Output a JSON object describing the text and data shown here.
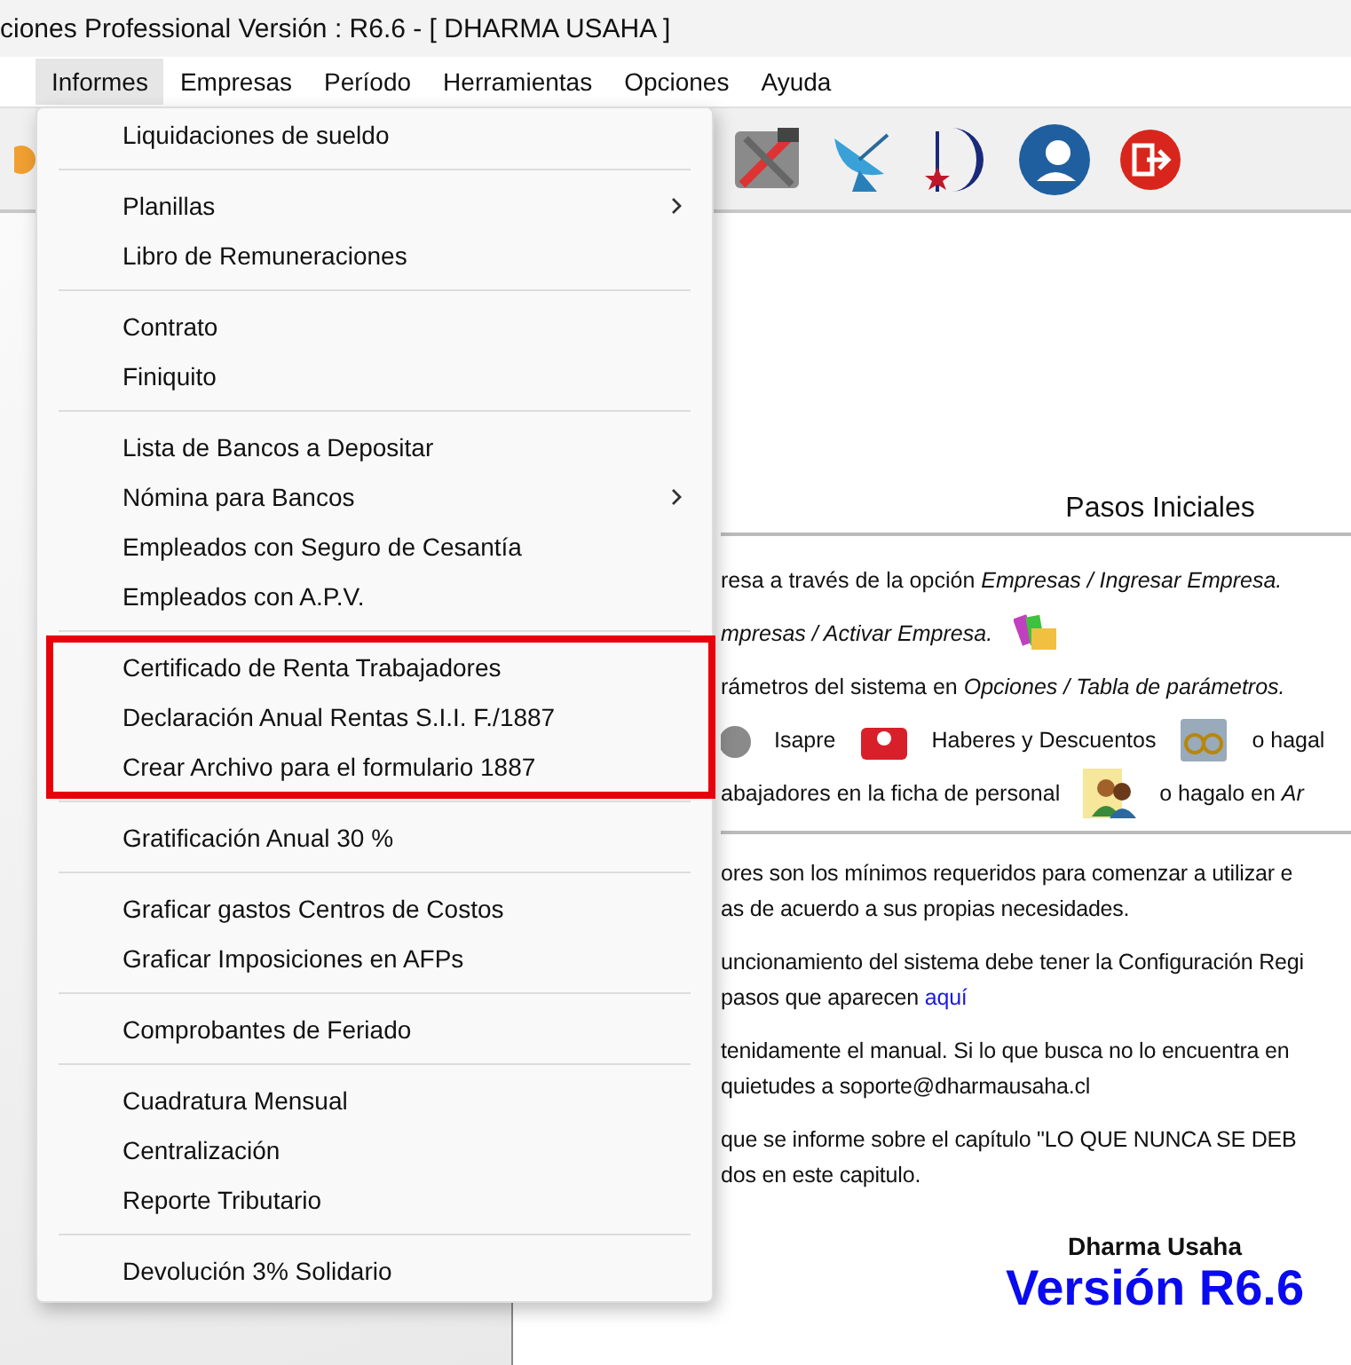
{
  "window": {
    "title": "ciones Professional Versión : R6.6  - [ DHARMA USAHA ]"
  },
  "menu_bar": [
    {
      "label": "Informes",
      "selected": true
    },
    {
      "label": "Empresas",
      "selected": false
    },
    {
      "label": "Período",
      "selected": false
    },
    {
      "label": "Herramientas",
      "selected": false
    },
    {
      "label": "Opciones",
      "selected": false
    },
    {
      "label": "Ayuda",
      "selected": false
    }
  ],
  "toolbar_icons": [
    {
      "kind": "tools"
    },
    {
      "kind": "dish"
    },
    {
      "kind": "logo"
    },
    {
      "kind": "support"
    },
    {
      "kind": "exit"
    }
  ],
  "dropdown": {
    "groups": [
      {
        "highlighted": false,
        "items": [
          {
            "label": "Liquidaciones de sueldo",
            "submenu": false
          }
        ]
      },
      {
        "highlighted": false,
        "items": [
          {
            "label": "Planillas",
            "submenu": true
          },
          {
            "label": "Libro de Remuneraciones",
            "submenu": false
          }
        ]
      },
      {
        "highlighted": false,
        "items": [
          {
            "label": "Contrato",
            "submenu": false
          },
          {
            "label": "Finiquito",
            "submenu": false
          }
        ]
      },
      {
        "highlighted": false,
        "items": [
          {
            "label": "Lista de Bancos a Depositar",
            "submenu": false
          },
          {
            "label": "Nómina para Bancos",
            "submenu": true
          },
          {
            "label": "Empleados con Seguro de Cesantía",
            "submenu": false
          },
          {
            "label": "Empleados con A.P.V.",
            "submenu": false
          }
        ]
      },
      {
        "highlighted": true,
        "items": [
          {
            "label": "Certificado de Renta Trabajadores",
            "submenu": false
          },
          {
            "label": "Declaración Anual Rentas S.I.I. F./1887",
            "submenu": false
          },
          {
            "label": "Crear Archivo para el formulario 1887",
            "submenu": false
          }
        ]
      },
      {
        "highlighted": false,
        "items": [
          {
            "label": "Gratificación Anual 30 %",
            "submenu": false
          }
        ]
      },
      {
        "highlighted": false,
        "items": [
          {
            "label": "Graficar gastos Centros de Costos",
            "submenu": false
          },
          {
            "label": "Graficar Imposiciones en AFPs",
            "submenu": false
          }
        ]
      },
      {
        "highlighted": false,
        "items": [
          {
            "label": "Comprobantes de Feriado",
            "submenu": false
          }
        ]
      },
      {
        "highlighted": false,
        "items": [
          {
            "label": "Cuadratura Mensual",
            "submenu": false
          },
          {
            "label": "Centralización",
            "submenu": false
          },
          {
            "label": "Reporte Tributario",
            "submenu": false
          }
        ]
      },
      {
        "highlighted": false,
        "items": [
          {
            "label": "Devolución 3% Solidario",
            "submenu": false
          }
        ]
      }
    ]
  },
  "panel": {
    "heading": "Pasos Iniciales",
    "steps": [
      [
        {
          "kind": "text",
          "text": "resa a través de la opción *Empresas / Ingresar Empresa.*"
        }
      ],
      [
        {
          "kind": "text",
          "text": "*mpresas / Activar Empresa.*"
        },
        {
          "kind": "folders"
        }
      ],
      [
        {
          "kind": "text",
          "text": "rámetros del sistema en *Opciones / Tabla de parámetros.*"
        }
      ],
      [
        {
          "kind": "piggy"
        },
        {
          "kind": "text",
          "text": "Isapre"
        },
        {
          "kind": "firstaid"
        },
        {
          "kind": "text",
          "text": "Haberes y Descuentos"
        },
        {
          "kind": "calculator"
        },
        {
          "kind": "text",
          "text": "o hagal"
        }
      ],
      [
        {
          "kind": "text",
          "text": "abajadores en la ficha de personal"
        },
        {
          "kind": "people"
        },
        {
          "kind": "text",
          "text": "o hagalo en  *Ar*"
        }
      ]
    ],
    "notes": [
      {
        "lines": [
          {
            "text": "ores son los mínimos requeridos para comenzar a utilizar e"
          },
          {
            "text": "as de acuerdo a sus propias necesidades."
          }
        ]
      },
      {
        "lines": [
          {
            "text": "uncionamiento del sistema debe tener la Configuración Regi"
          },
          {
            "text": "pasos que aparecen",
            "link": "aquí"
          }
        ]
      },
      {
        "lines": [
          {
            "text": "tenidamente el manual. Si lo que busca no lo encuentra en"
          },
          {
            "text": "quietudes a soporte@dharmausaha.cl"
          }
        ]
      },
      {
        "lines": [
          {
            "text": "que se informe sobre el capítulo \"LO QUE NUNCA SE DEB"
          },
          {
            "text": "dos en este capitulo."
          }
        ]
      }
    ],
    "brand": "Dharma Usaha",
    "version": "Versión R6.6"
  }
}
